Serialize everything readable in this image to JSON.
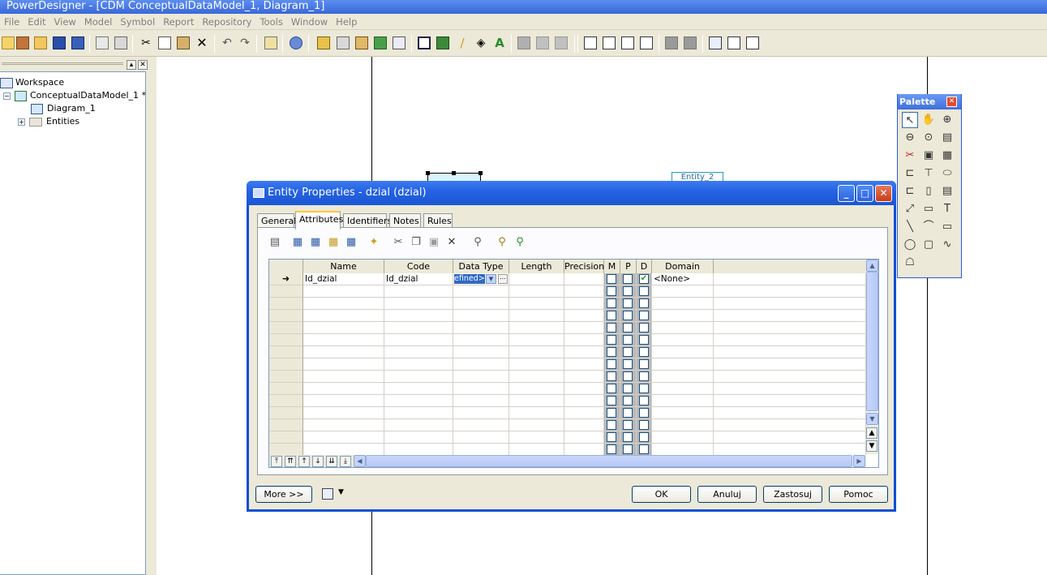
{
  "window": {
    "title": "PowerDesigner - [CDM ConceptualDataModel_1, Diagram_1]"
  },
  "menu": [
    "File",
    "Edit",
    "View",
    "Model",
    "Symbol",
    "Report",
    "Repository",
    "Tools",
    "Window",
    "Help"
  ],
  "tree": {
    "workspace": "Workspace",
    "model": "ConceptualDataModel_1 *",
    "diagram": "Diagram_1",
    "entities": "Entities"
  },
  "canvas": {
    "entity2_label": "Entity_2"
  },
  "palette": {
    "title": "Palette",
    "close": "✕"
  },
  "dialog": {
    "title": "Entity Properties - dzial (dzial)",
    "tabs": [
      "General",
      "Attributes",
      "Identifiers",
      "Notes",
      "Rules"
    ],
    "active_tab": "Attributes",
    "columns": [
      "Name",
      "Code",
      "Data Type",
      "Length",
      "Precision",
      "M",
      "P",
      "D",
      "Domain"
    ],
    "rows": [
      {
        "marker": "➜",
        "name": "Id_dzial",
        "code": "Id_dzial",
        "data_type": "efined>",
        "length": "",
        "precision": "",
        "M": false,
        "P": false,
        "D": true,
        "domain": "<None>"
      }
    ],
    "empty_rows": 14,
    "buttons": {
      "more": "More >>",
      "ok": "OK",
      "cancel": "Anuluj",
      "apply": "Zastosuj",
      "help": "Pomoc"
    },
    "ellipsis": "..."
  },
  "colors": {
    "title_blue": "#2563e3",
    "dialog_border": "#0c4fd8",
    "face": "#ece9d8",
    "selection": "#316ac5"
  }
}
